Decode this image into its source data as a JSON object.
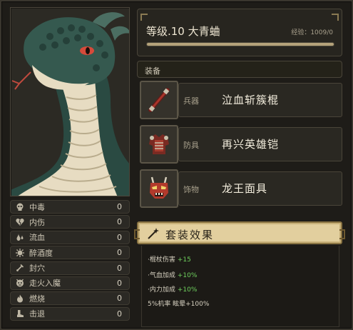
{
  "character": {
    "level_title": "等级.10 大青蛐",
    "exp_text": "经验：1009/0",
    "exp_fraction": 1.0
  },
  "equipment_header": "装备",
  "equipment": [
    {
      "type": "兵器",
      "name": "泣血斩簇棍",
      "icon": "weapon-staff-icon"
    },
    {
      "type": "防具",
      "name": "再兴英雄铠",
      "icon": "armor-icon"
    },
    {
      "type": "饰物",
      "name": "龙王面具",
      "icon": "demon-mask-icon"
    }
  ],
  "set_effect": {
    "title": "套装效果",
    "lines": [
      {
        "text": "·棍杖伤害",
        "bonus": "+15"
      },
      {
        "text": "·气血加成",
        "bonus": "+10%"
      },
      {
        "text": "·内力加成",
        "bonus": "+10%"
      },
      {
        "text": "5%机率 眩晕+100%",
        "bonus": ""
      }
    ]
  },
  "status": [
    {
      "label": "中毒",
      "value": "0",
      "icon": "skull-icon"
    },
    {
      "label": "内伤",
      "value": "0",
      "icon": "broken-heart-icon"
    },
    {
      "label": "流血",
      "value": "0",
      "icon": "blood-drop-icon"
    },
    {
      "label": "醉酒度",
      "value": "0",
      "icon": "dizzy-icon"
    },
    {
      "label": "封穴",
      "value": "0",
      "icon": "acupoint-icon"
    },
    {
      "label": "走火入魔",
      "value": "0",
      "icon": "demon-face-icon"
    },
    {
      "label": "燃烧",
      "value": "0",
      "icon": "flame-icon"
    },
    {
      "label": "击退",
      "value": "0",
      "icon": "boot-icon"
    }
  ],
  "colors": {
    "panel": "#1e1c18",
    "accent_gold": "#e2cf9e",
    "bonus_green": "#6fd15e",
    "serpent_green": "#2f5148"
  }
}
